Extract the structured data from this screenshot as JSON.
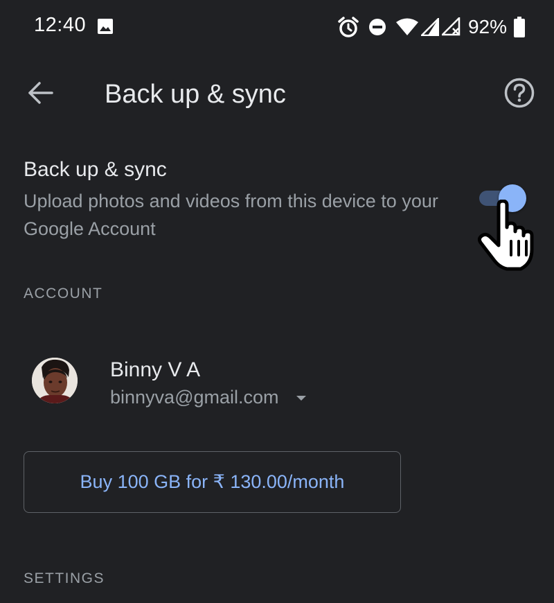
{
  "status_bar": {
    "time": "12:40",
    "battery_percent": "92%",
    "icons": [
      "gallery-icon",
      "alarm-icon",
      "do-not-disturb-icon",
      "wifi-icon",
      "signal-icon",
      "signal-no-data-icon",
      "battery-icon"
    ]
  },
  "app_bar": {
    "title": "Back up & sync",
    "back_icon": "arrow-back-icon",
    "help_icon": "help-circle-icon"
  },
  "backup": {
    "title": "Back up & sync",
    "description": "Upload photos and videos from this device to your Google Account",
    "enabled": true
  },
  "account_section": {
    "header": "ACCOUNT",
    "name": "Binny V A",
    "email": "binnyva@gmail.com"
  },
  "storage_offer": {
    "label": "Buy 100 GB for ₹ 130.00/month"
  },
  "settings_section": {
    "header": "SETTINGS"
  },
  "colors": {
    "background": "#202124",
    "accent": "#8ab4f8",
    "toggle_track": "#3f5375",
    "secondary_text": "#9aa0a6",
    "primary_text": "#e8eaed"
  }
}
